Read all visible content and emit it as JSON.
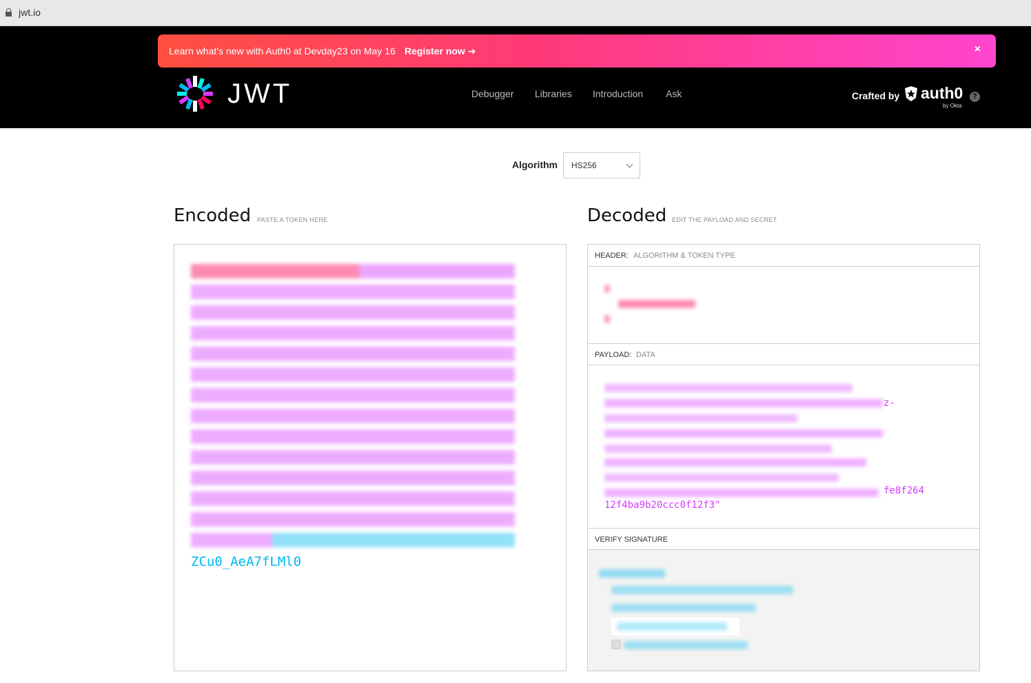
{
  "browser": {
    "url": "jwt.io"
  },
  "banner": {
    "message": "Learn what's new with Auth0 at Devday23 on May 16",
    "cta": "Register now ➔",
    "close": "×"
  },
  "brand": {
    "wordmark": "JWT"
  },
  "nav": [
    {
      "label": "Debugger"
    },
    {
      "label": "Libraries"
    },
    {
      "label": "Introduction"
    },
    {
      "label": "Ask"
    }
  ],
  "crafted": {
    "label": "Crafted by",
    "brand": "auth0",
    "sub": "by Okta",
    "help": "?"
  },
  "algorithm": {
    "label": "Algorithm",
    "value": "HS256"
  },
  "encoded": {
    "title": "Encoded",
    "subtitle": "PASTE A TOKEN HERE",
    "token_visible_tail": "ZCu0_AeA7fLMl0"
  },
  "decoded": {
    "title": "Decoded",
    "subtitle": "EDIT THE PAYLOAD AND SECRET",
    "header": {
      "key": "HEADER:",
      "desc": "ALGORITHM & TOKEN TYPE"
    },
    "payload": {
      "key": "PAYLOAD:",
      "desc": "DATA",
      "visible_tail_1": "z-",
      "visible_tail_2": "fe8f264",
      "visible_tail_3": "12f4ba9b20ccc0f12f3\""
    },
    "verify": {
      "key": "VERIFY SIGNATURE"
    }
  },
  "colors": {
    "header_part": "#fb015b",
    "payload_part": "#d63aff",
    "signature_part": "#00b9f1"
  }
}
